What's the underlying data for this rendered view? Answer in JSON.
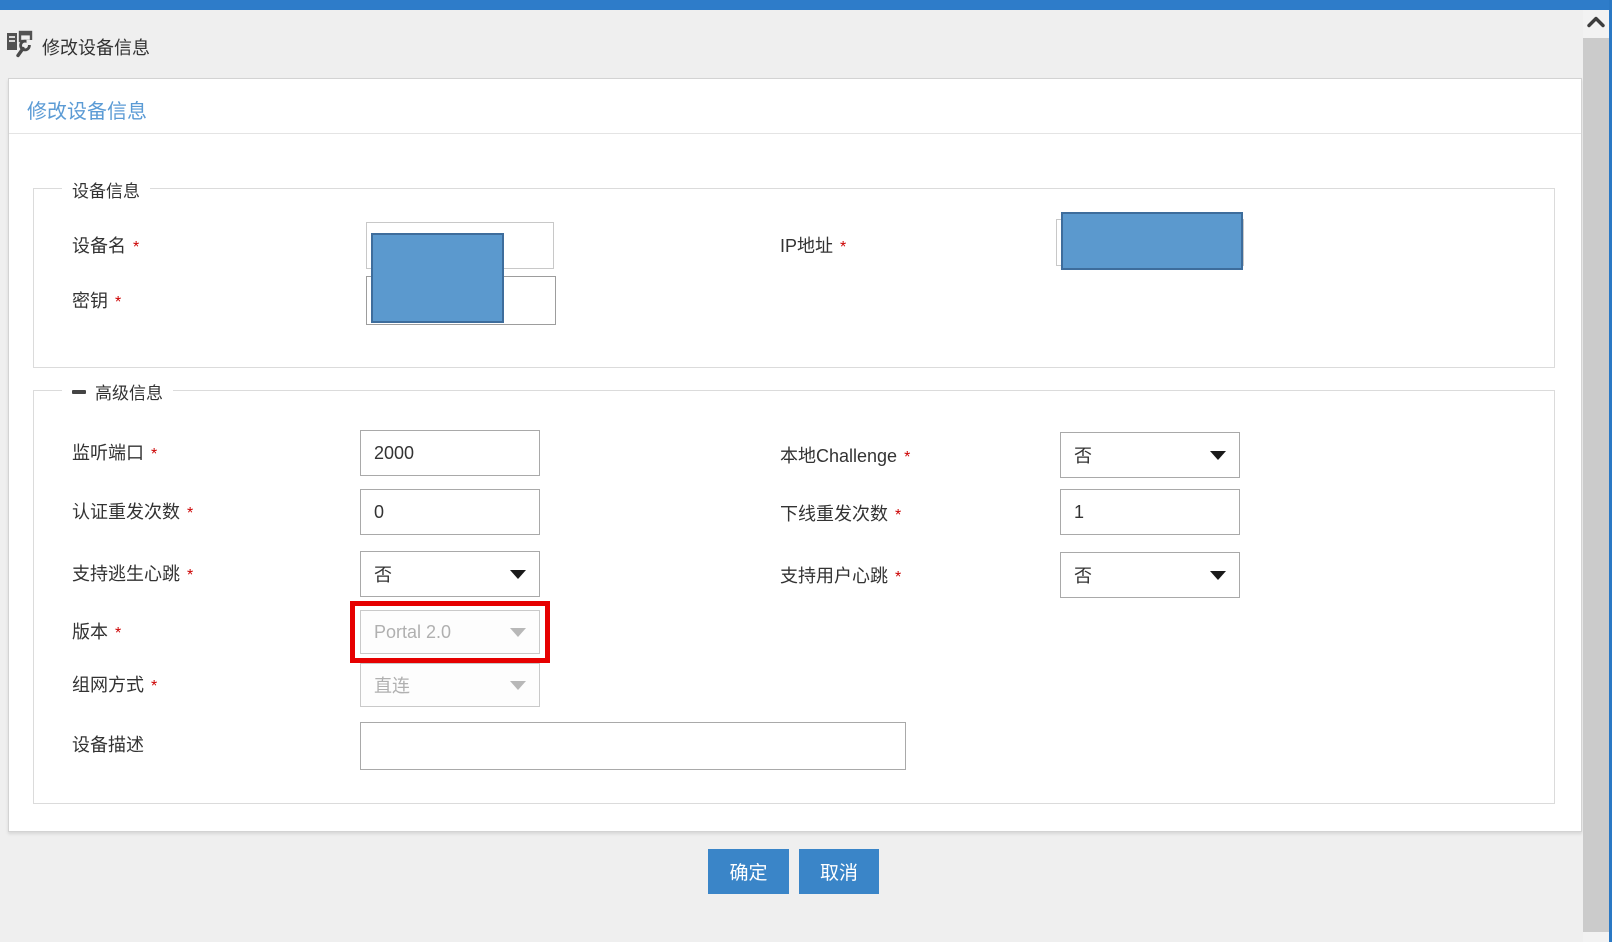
{
  "ui": {
    "required_marker": "*"
  },
  "header": {
    "title": "修改设备信息",
    "icon": "device-edit-icon"
  },
  "panel": {
    "title": "修改设备信息"
  },
  "device_section": {
    "legend": "设备信息",
    "device_name": {
      "label": "设备名",
      "value": "",
      "required": true,
      "redacted": true
    },
    "secret_key": {
      "label": "密钥",
      "value": "",
      "required": true,
      "redacted": true
    },
    "ip_address": {
      "label": "IP地址",
      "value": "",
      "required": true,
      "redacted": true
    }
  },
  "advanced_section": {
    "legend": "高级信息",
    "collapse_icon": "minus-icon",
    "listen_port": {
      "label": "监听端口",
      "value": "2000",
      "required": true
    },
    "local_challenge": {
      "label": "本地Challenge",
      "value": "否",
      "required": true
    },
    "auth_resend": {
      "label": "认证重发次数",
      "value": "0",
      "required": true
    },
    "offline_resend": {
      "label": "下线重发次数",
      "value": "1",
      "required": true
    },
    "escape_heartbeat": {
      "label": "支持逃生心跳",
      "value": "否",
      "required": true
    },
    "user_heartbeat": {
      "label": "支持用户心跳",
      "value": "否",
      "required": true
    },
    "version": {
      "label": "版本",
      "value": "Portal 2.0",
      "required": true,
      "disabled": true,
      "highlighted": true
    },
    "networking_mode": {
      "label": "组网方式",
      "value": "直连",
      "required": true,
      "disabled": true
    },
    "device_desc": {
      "label": "设备描述",
      "value": ""
    }
  },
  "actions": {
    "ok": "确定",
    "cancel": "取消"
  },
  "scrollbar": {
    "up_icon": "chevron-up-icon"
  },
  "colors": {
    "topbar_blue": "#2e7cc9",
    "button_blue": "#3a85c8",
    "panel_title_blue": "#5b9bd5",
    "required_red": "#cc0000",
    "redaction_fill": "#5b99ce",
    "redaction_border": "#3e6d9c",
    "highlight_red": "#e60000"
  }
}
